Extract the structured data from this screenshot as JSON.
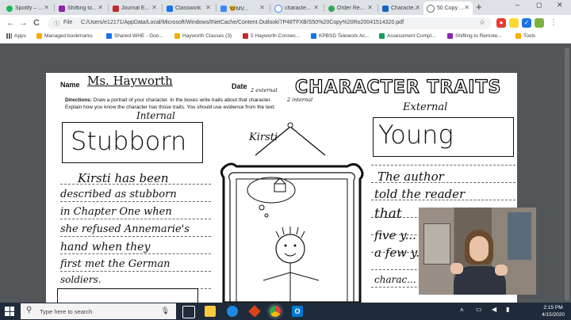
{
  "browser": {
    "tabs": [
      {
        "label": "Spotify – ...",
        "color": "#1db954"
      },
      {
        "label": "Shifting to...",
        "color": "#8e24aa"
      },
      {
        "label": "Journal E...",
        "color": "#c62828"
      },
      {
        "label": "Classwork",
        "color": "#1a73e8"
      },
      {
        "label": "🤓MV...",
        "color": "#4285f4"
      },
      {
        "label": "characte...",
        "color": "#5f6368"
      },
      {
        "label": "Order Re...",
        "color": "#34a853"
      },
      {
        "label": "Characte...",
        "color": "#1565c0"
      },
      {
        "label": "50 Copy ...",
        "color": "#5f6368"
      }
    ],
    "new_tab": "+",
    "window_controls": {
      "minimize": "–",
      "maximize": "◻",
      "close": "✕"
    },
    "nav": {
      "back": "←",
      "forward": "→",
      "reload": "C"
    },
    "omnibox": {
      "label": "File",
      "url": "C:/Users/e12171/AppData/Local/Microsoft/Windows/INetCache/Content.Outlook/7P48TFXB/S50%20Copy%20Ro20041514320.pdf"
    }
  },
  "bookmarks": [
    {
      "label": "Apps",
      "color": "#5f6368"
    },
    {
      "label": "Managed bookmarks",
      "color": "#f9ab00"
    },
    {
      "label": "Shared-WHE - Goo...",
      "color": "#1a73e8"
    },
    {
      "label": "Hayworth Classes (3)",
      "color": "#f9ab00"
    },
    {
      "label": "5 Hayworth Connec...",
      "color": "#c62828"
    },
    {
      "label": "KPBSD Telework Ac...",
      "color": "#1a73e8"
    },
    {
      "label": "Assessment Compl...",
      "color": "#0f9d58"
    },
    {
      "label": "Shifting to Remote...",
      "color": "#8e24aa"
    },
    {
      "label": "Tools",
      "color": "#f9ab00"
    }
  ],
  "worksheet": {
    "name_label": "Name",
    "name_value": "Ms. Hayworth",
    "date_label": "Date",
    "date_notes": [
      "2 external",
      "2 internal"
    ],
    "title": "CHARACTER TRAITS",
    "directions_label": "Directions:",
    "directions_text": "Draw a portrait of your character. In the boxes write traits about that character. Explain how you know the character has those traits. You should use evidence from the text.",
    "internal_label": "Internal",
    "external_label": "External",
    "character_name": "Kirsti",
    "trait_left": "Stubborn",
    "trait_right": "Young",
    "evidence_left": [
      "Kirsti has been",
      "described as stubborn",
      "in Chapter One when",
      "she refused Annemarie's",
      "hand when they",
      "first met the German",
      "soldiers."
    ],
    "evidence_right": [
      "The author",
      "told the reader",
      "that",
      "five y...",
      "a few y...",
      "charac..."
    ]
  },
  "taskbar": {
    "search_placeholder": "Type here to search",
    "time": "2:15 PM",
    "date": "4/15/2020"
  }
}
